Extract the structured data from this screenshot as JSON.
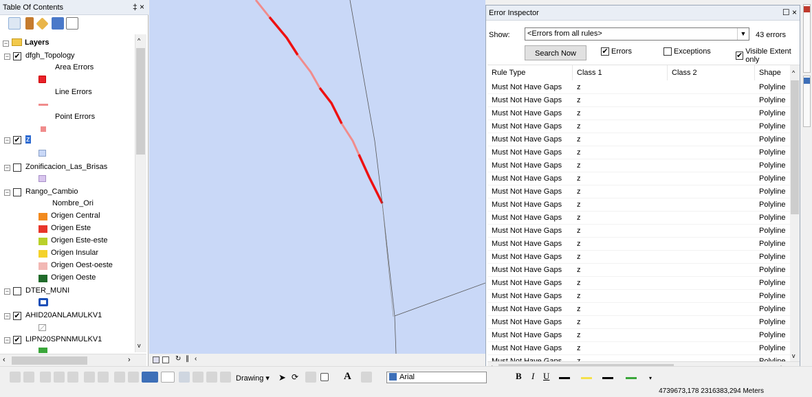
{
  "toc": {
    "title": "Table Of Contents",
    "pin_close": "4 ×",
    "items": [
      {
        "label": "Layers"
      },
      {
        "label": "dfgh_Topology"
      },
      {
        "label": "Area Errors"
      },
      {
        "label": "Line Errors"
      },
      {
        "label": "Point Errors"
      },
      {
        "label": "z"
      },
      {
        "label": "Zonificacion_Las_Brisas"
      },
      {
        "label": "Rango_Cambio"
      },
      {
        "label": "Nombre_Ori"
      },
      {
        "label": "Origen Central"
      },
      {
        "label": "Origen Este"
      },
      {
        "label": "Origen Este-este"
      },
      {
        "label": "Origen Insular"
      },
      {
        "label": "Origen Oest-oeste"
      },
      {
        "label": "Origen Oeste"
      },
      {
        "label": "DTER_MUNI"
      },
      {
        "label": "AHID20ANLAMULKV1"
      },
      {
        "label": "LIPN20SPNNMULKV1"
      }
    ],
    "legend_colors": {
      "area": "#e8222a",
      "line": "#f08c8c",
      "point": "#f08c8c",
      "z": "#c9d8f7",
      "zonificacion": "#d9c6ee",
      "central": "#f28a1e",
      "este": "#e8352a",
      "este_este": "#b9d02a",
      "insular": "#f4d22a",
      "oest_oeste": "#f2b8b4",
      "oeste": "#1f6b2a",
      "dter": "#1a4fb8"
    }
  },
  "error_inspector": {
    "title": "Error Inspector",
    "show_label": "Show:",
    "show_value": "<Errors from all rules>",
    "error_count": "43 errors",
    "search_button": "Search Now",
    "errors_label": "Errors",
    "exceptions_label": "Exceptions",
    "visible_extent_label": "Visible Extent only",
    "columns": [
      "Rule Type",
      "Class 1",
      "Class 2",
      "Shape"
    ],
    "rows": [
      {
        "rule": "Must Not Have Gaps",
        "class1": "z",
        "class2": "",
        "shape": "Polyline"
      },
      {
        "rule": "Must Not Have Gaps",
        "class1": "z",
        "class2": "",
        "shape": "Polyline"
      },
      {
        "rule": "Must Not Have Gaps",
        "class1": "z",
        "class2": "",
        "shape": "Polyline"
      },
      {
        "rule": "Must Not Have Gaps",
        "class1": "z",
        "class2": "",
        "shape": "Polyline"
      },
      {
        "rule": "Must Not Have Gaps",
        "class1": "z",
        "class2": "",
        "shape": "Polyline"
      },
      {
        "rule": "Must Not Have Gaps",
        "class1": "z",
        "class2": "",
        "shape": "Polyline"
      },
      {
        "rule": "Must Not Have Gaps",
        "class1": "z",
        "class2": "",
        "shape": "Polyline"
      },
      {
        "rule": "Must Not Have Gaps",
        "class1": "z",
        "class2": "",
        "shape": "Polyline"
      },
      {
        "rule": "Must Not Have Gaps",
        "class1": "z",
        "class2": "",
        "shape": "Polyline"
      },
      {
        "rule": "Must Not Have Gaps",
        "class1": "z",
        "class2": "",
        "shape": "Polyline"
      },
      {
        "rule": "Must Not Have Gaps",
        "class1": "z",
        "class2": "",
        "shape": "Polyline"
      },
      {
        "rule": "Must Not Have Gaps",
        "class1": "z",
        "class2": "",
        "shape": "Polyline"
      },
      {
        "rule": "Must Not Have Gaps",
        "class1": "z",
        "class2": "",
        "shape": "Polyline"
      },
      {
        "rule": "Must Not Have Gaps",
        "class1": "z",
        "class2": "",
        "shape": "Polyline"
      },
      {
        "rule": "Must Not Have Gaps",
        "class1": "z",
        "class2": "",
        "shape": "Polyline"
      },
      {
        "rule": "Must Not Have Gaps",
        "class1": "z",
        "class2": "",
        "shape": "Polyline"
      },
      {
        "rule": "Must Not Have Gaps",
        "class1": "z",
        "class2": "",
        "shape": "Polyline"
      },
      {
        "rule": "Must Not Have Gaps",
        "class1": "z",
        "class2": "",
        "shape": "Polyline"
      },
      {
        "rule": "Must Not Have Gaps",
        "class1": "z",
        "class2": "",
        "shape": "Polyline"
      },
      {
        "rule": "Must Not Have Gaps",
        "class1": "z",
        "class2": "",
        "shape": "Polyline"
      },
      {
        "rule": "Must Not Have Gaps",
        "class1": "z",
        "class2": "",
        "shape": "Polyline"
      },
      {
        "rule": "Must Not Have Gaps",
        "class1": "z",
        "class2": "",
        "shape": "Polyline"
      }
    ]
  },
  "toolbar": {
    "drawing_label": "Drawing",
    "font_value": "Arial"
  },
  "status": {
    "coordinates": "4739673,178  2316383,294 Meters"
  }
}
